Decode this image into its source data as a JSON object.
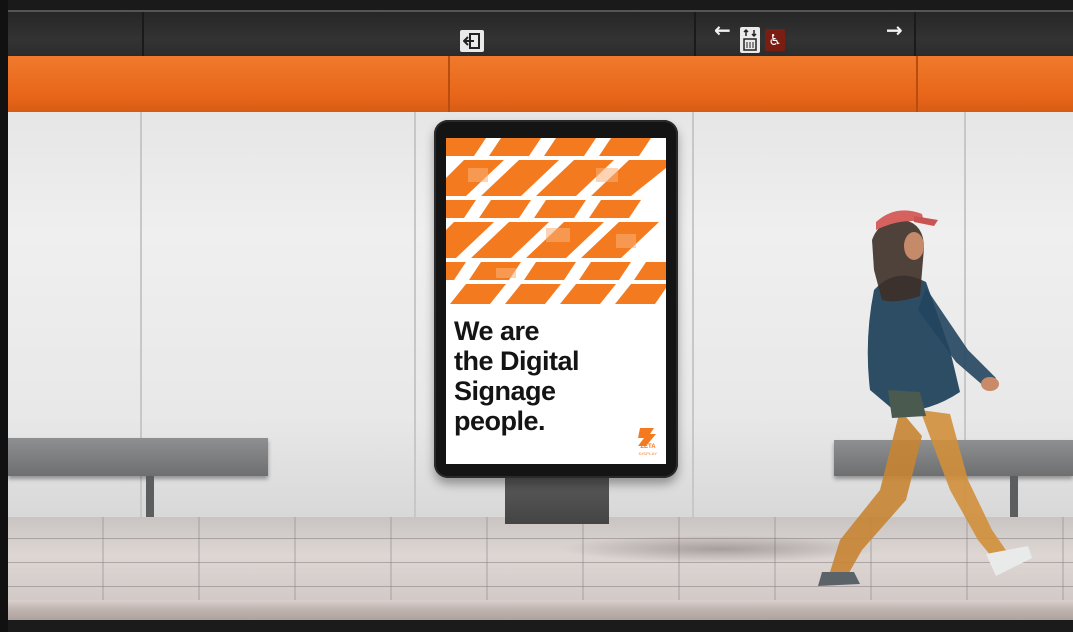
{
  "scene": {
    "description_free": true,
    "station_signage": {
      "exit_icon": "exit-door-icon",
      "left_arrow": "←",
      "lift_icon": "lift-icon",
      "accessible_icon": "wheelchair-icon",
      "accessible_glyph": "♿",
      "right_arrow": "→"
    },
    "colors": {
      "orange_band": "#ee7228",
      "poster_orange": "#f47a20",
      "wall": "#ececec",
      "sign_band": "#2c2c2c"
    }
  },
  "poster": {
    "headline": "We are\nthe Digital\nSignage\npeople.",
    "logo_word": "ZETA",
    "logo_sub": "DISPLAY",
    "pattern_icon": "zeta-z-pattern"
  }
}
